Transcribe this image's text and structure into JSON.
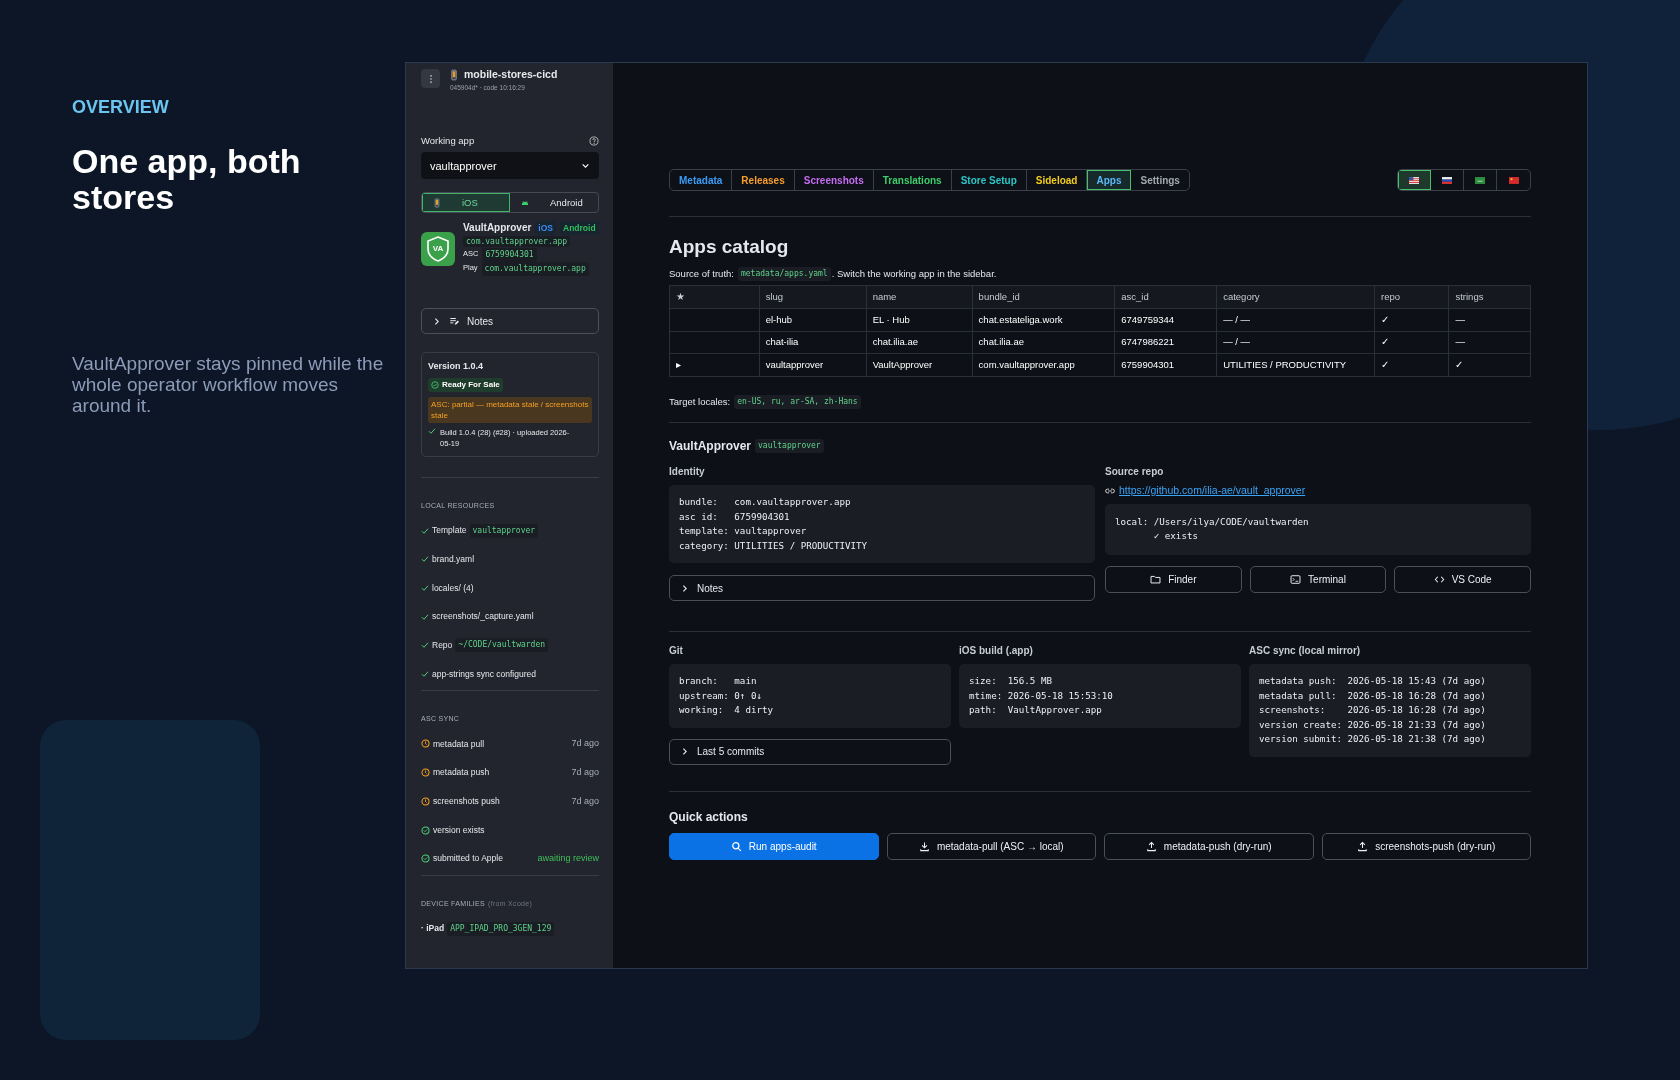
{
  "promo": {
    "eyebrow": "OVERVIEW",
    "title": "One app, both stores",
    "body": "VaultApprover stays pinned while the whole operator workflow moves around it."
  },
  "sidebar": {
    "project": {
      "title": "mobile-stores-cicd",
      "subtitle": "045904d* · code 10:16:29"
    },
    "working_app": {
      "label": "Working app",
      "value": "vaultapprover"
    },
    "platforms": [
      {
        "label": "iOS",
        "kind": "phone",
        "selected": true
      },
      {
        "label": "Android",
        "kind": "android",
        "selected": false
      }
    ],
    "app": {
      "icon_text": "VA",
      "name": "VaultApprover",
      "badges": [
        {
          "label": "iOS",
          "color": "#3b8bf5"
        },
        {
          "label": "Android",
          "color": "#2fbf5b"
        }
      ],
      "bundle": "com.vaultapprover.app",
      "asc_label": "ASC",
      "asc_id": "6759904301",
      "play_label": "Play",
      "play_id": "com.vaultapprover.app"
    },
    "notes": {
      "label": "Notes",
      "expanded": false
    },
    "version": {
      "title": "Version 1.0.4",
      "status": "Ready For Sale",
      "warning": "ASC: partial — metadata stale / screenshots stale",
      "build": "Build 1.0.4 (28) (#28) · uploaded 2026-05-19"
    },
    "local_resources": {
      "heading": "LOCAL RESOURCES",
      "items": [
        {
          "label": "Template",
          "code": "vaultapprover"
        },
        {
          "label": "brand.yaml"
        },
        {
          "label": "locales/ (4)"
        },
        {
          "label": "screenshots/_capture.yaml"
        },
        {
          "label": "Repo",
          "code": "~/CODE/vaultwarden"
        },
        {
          "label": "app-strings sync configured"
        }
      ]
    },
    "asc_sync": {
      "heading": "ASC SYNC",
      "items": [
        {
          "kind": "pending",
          "label": "metadata pull",
          "note": "7d ago"
        },
        {
          "kind": "pending",
          "label": "metadata push",
          "note": "7d ago"
        },
        {
          "kind": "pending",
          "label": "screenshots push",
          "note": "7d ago"
        },
        {
          "kind": "done",
          "label": "version exists"
        },
        {
          "kind": "done",
          "label": "submitted to Apple",
          "note": "awaiting review"
        }
      ]
    },
    "device_families": {
      "heading": "DEVICE FAMILIES",
      "hint": "(from Xcode)",
      "items": [
        {
          "label": "· iPad",
          "code": "APP_IPAD_PRO_3GEN_129"
        }
      ]
    }
  },
  "main": {
    "tabs": [
      {
        "label": "Metadata",
        "color": "#3b9cf5",
        "selected": false
      },
      {
        "label": "Releases",
        "color": "#f59e2b",
        "selected": false
      },
      {
        "label": "Screenshots",
        "color": "#c56cf0",
        "selected": false
      },
      {
        "label": "Translations",
        "color": "#3fcf6a",
        "selected": false
      },
      {
        "label": "Store Setup",
        "color": "#2cc6c6",
        "selected": false
      },
      {
        "label": "Sideload",
        "color": "#f2cc1f",
        "selected": false
      },
      {
        "label": "Apps",
        "color": "#5ab8f5",
        "selected": true
      },
      {
        "label": "Settings",
        "color": "#a3a8b3",
        "selected": false
      }
    ],
    "locales": [
      {
        "kind": "us",
        "selected": true
      },
      {
        "kind": "ru",
        "selected": false
      },
      {
        "kind": "sa",
        "selected": false
      },
      {
        "kind": "cn",
        "selected": false
      }
    ],
    "catalog": {
      "title": "Apps catalog",
      "source_label": "Source of truth:",
      "source_code": "metadata/apps.yaml",
      "source_note": ". Switch the working app in the sidebar.",
      "table": {
        "columns": [
          "★",
          "slug",
          "name",
          "bundle_id",
          "asc_id",
          "category",
          "repo",
          "strings"
        ],
        "rows": [
          {
            "cells": [
              "",
              "el-hub",
              "EL · Hub",
              "chat.estateliga.work",
              "6749759344",
              "— / —",
              "✓",
              "—"
            ]
          },
          {
            "cells": [
              "",
              "chat-ilia",
              "chat.ilia.ae",
              "chat.ilia.ae",
              "6747986221",
              "— / —",
              "✓",
              "—"
            ]
          },
          {
            "cells": [
              "▸",
              "vaultapprover",
              "VaultApprover",
              "com.vaultapprover.app",
              "6759904301",
              "UTILITIES / PRODUCTIVITY",
              "✓",
              "✓"
            ]
          }
        ]
      },
      "locales_label": "Target locales:",
      "locales_code": "en-US, ru, ar-SA, zh-Hans"
    },
    "detail": {
      "name": "VaultApprover",
      "slug": "vaultapprover",
      "identity": {
        "label": "Identity",
        "lines": [
          "bundle:   com.vaultapprover.app",
          "asc id:   6759904301",
          "template: vaultapprover",
          "category: UTILITIES / PRODUCTIVITY"
        ]
      },
      "notes": {
        "label": "Notes",
        "expanded": false
      },
      "source_repo": {
        "label": "Source repo",
        "url": "https://github.com/ilia-ae/vault_approver",
        "lines": [
          "local: /Users/ilya/CODE/vaultwarden",
          "       ✓ exists"
        ],
        "buttons": [
          {
            "kind": "folder",
            "label": "Finder"
          },
          {
            "kind": "terminal",
            "label": "Terminal"
          },
          {
            "kind": "code",
            "label": "VS Code"
          }
        ]
      }
    },
    "status": [
      {
        "title": "Git",
        "lines": [
          "branch:   main",
          "upstream: 0↑ 0↓",
          "working:  4 dirty"
        ],
        "collapsible": {
          "label": "Last 5 commits",
          "expanded": false
        }
      },
      {
        "title": "iOS build (.app)",
        "lines": [
          "size:  156.5 MB",
          "mtime: 2026-05-18 15:53:10",
          "path:  VaultApprover.app"
        ]
      },
      {
        "title": "ASC sync (local mirror)",
        "lines": [
          "metadata push:  2026-05-18 15:43 (7d ago)",
          "metadata pull:  2026-05-18 16:28 (7d ago)",
          "screenshots:    2026-05-18 16:28 (7d ago)",
          "version create: 2026-05-18 21:33 (7d ago)",
          "version submit: 2026-05-18 21:38 (7d ago)"
        ]
      }
    ],
    "quick_actions": {
      "title": "Quick actions",
      "buttons": [
        {
          "kind": "search",
          "label": "Run apps-audit",
          "primary": true
        },
        {
          "kind": "download",
          "label": "metadata-pull (ASC → local)",
          "primary": false
        },
        {
          "kind": "upload",
          "label": "metadata-push (dry-run)",
          "primary": false
        },
        {
          "kind": "upload",
          "label": "screenshots-push (dry-run)",
          "primary": false
        }
      ]
    }
  }
}
